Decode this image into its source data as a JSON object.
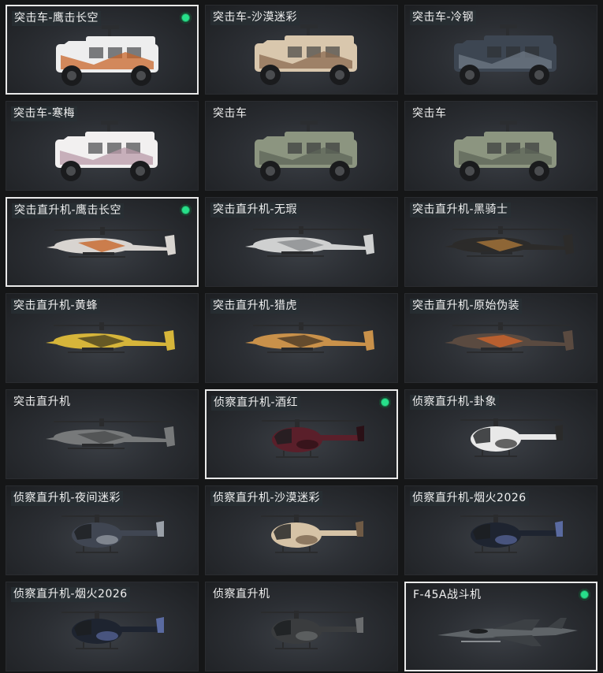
{
  "colors": {
    "equipped": "#27e08a",
    "selected_border": "#e9e9e9",
    "label_bg": "#283034"
  },
  "cards": [
    {
      "label": "突击车-鹰击长空",
      "selected": true,
      "equipped": true,
      "kind": "truck",
      "icon": "assault-vehicle-icon",
      "paint": [
        "#eeeeee",
        "#c8662a"
      ]
    },
    {
      "label": "突击车-沙漠迷彩",
      "selected": false,
      "equipped": false,
      "kind": "truck",
      "icon": "assault-vehicle-icon",
      "paint": [
        "#d9c7ad",
        "#8a6a50"
      ]
    },
    {
      "label": "突击车-冷钢",
      "selected": false,
      "equipped": false,
      "kind": "truck",
      "icon": "assault-vehicle-icon",
      "paint": [
        "#3d4652",
        "#6f7a86"
      ]
    },
    {
      "label": "突击车-寒梅",
      "selected": false,
      "equipped": false,
      "kind": "truck",
      "icon": "assault-vehicle-icon",
      "paint": [
        "#f2f0f0",
        "#b89aa8"
      ]
    },
    {
      "label": "突击车",
      "selected": false,
      "equipped": false,
      "kind": "truck",
      "icon": "assault-vehicle-icon",
      "paint": [
        "#8c9580",
        "#5e6658"
      ]
    },
    {
      "label": "突击车",
      "selected": false,
      "equipped": false,
      "kind": "truck",
      "icon": "assault-vehicle-icon",
      "paint": [
        "#8c9580",
        "#5e6658"
      ]
    },
    {
      "label": "突击直升机-鹰击长空",
      "selected": true,
      "equipped": true,
      "kind": "attack-heli",
      "icon": "attack-helicopter-icon",
      "paint": [
        "#d8d4d0",
        "#c8662a"
      ]
    },
    {
      "label": "突击直升机-无瑕",
      "selected": false,
      "equipped": false,
      "kind": "attack-heli",
      "icon": "attack-helicopter-icon",
      "paint": [
        "#cfd0d0",
        "#8a8c8e"
      ]
    },
    {
      "label": "突击直升机-黑骑士",
      "selected": false,
      "equipped": false,
      "kind": "attack-heli",
      "icon": "attack-helicopter-icon",
      "paint": [
        "#2c2b2a",
        "#a8753a"
      ]
    },
    {
      "label": "突击直升机-黄蜂",
      "selected": false,
      "equipped": false,
      "kind": "attack-heli",
      "icon": "attack-helicopter-icon",
      "paint": [
        "#d6b53a",
        "#4a4220"
      ]
    },
    {
      "label": "突击直升机-猎虎",
      "selected": false,
      "equipped": false,
      "kind": "attack-heli",
      "icon": "attack-helicopter-icon",
      "paint": [
        "#c9914a",
        "#4b3a25"
      ]
    },
    {
      "label": "突击直升机-原始伪装",
      "selected": false,
      "equipped": false,
      "kind": "attack-heli",
      "icon": "attack-helicopter-icon",
      "paint": [
        "#5a4a40",
        "#d0642a"
      ]
    },
    {
      "label": "突击直升机",
      "selected": false,
      "equipped": false,
      "kind": "attack-heli",
      "icon": "attack-helicopter-icon",
      "paint": [
        "#77797a",
        "#4a4c4e"
      ]
    },
    {
      "label": "侦察直升机-酒红",
      "selected": true,
      "equipped": true,
      "kind": "scout-heli",
      "icon": "scout-helicopter-icon",
      "paint": [
        "#5a1f2a",
        "#2a1016"
      ]
    },
    {
      "label": "侦察直升机-卦象",
      "selected": false,
      "equipped": false,
      "kind": "scout-heli",
      "icon": "scout-helicopter-icon",
      "paint": [
        "#e8e8e8",
        "#2a2a2a"
      ]
    },
    {
      "label": "侦察直升机-夜间迷彩",
      "selected": false,
      "equipped": false,
      "kind": "scout-heli",
      "icon": "scout-helicopter-icon",
      "paint": [
        "#404652",
        "#9aa0a8"
      ]
    },
    {
      "label": "侦察直升机-沙漠迷彩",
      "selected": false,
      "equipped": false,
      "kind": "scout-heli",
      "icon": "scout-helicopter-icon",
      "paint": [
        "#d6c3a6",
        "#6f5a45"
      ]
    },
    {
      "label": "侦察直升机-烟火2026",
      "selected": false,
      "equipped": false,
      "kind": "scout-heli",
      "icon": "scout-helicopter-icon",
      "paint": [
        "#1e2430",
        "#5a6aa0"
      ]
    },
    {
      "label": "侦察直升机-烟火2026",
      "selected": false,
      "equipped": false,
      "kind": "scout-heli",
      "icon": "scout-helicopter-icon",
      "paint": [
        "#1e2430",
        "#5a6aa0"
      ]
    },
    {
      "label": "侦察直升机",
      "selected": false,
      "equipped": false,
      "kind": "scout-heli",
      "icon": "scout-helicopter-icon",
      "paint": [
        "#3a3c3e",
        "#6a6c6e"
      ]
    },
    {
      "label": "F-45A战斗机",
      "selected": true,
      "equipped": true,
      "kind": "jet",
      "icon": "fighter-jet-icon",
      "paint": [
        "#5f6468",
        "#3c4044"
      ]
    }
  ]
}
